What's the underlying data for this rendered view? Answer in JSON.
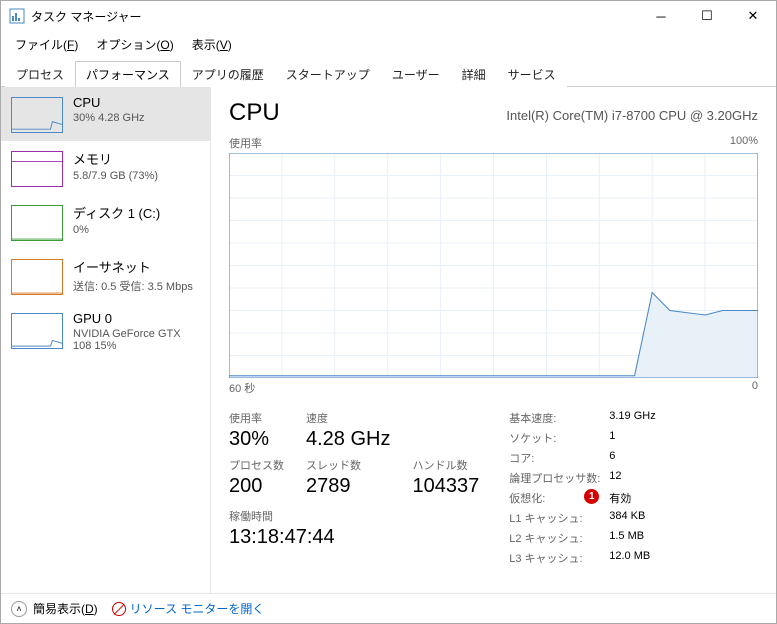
{
  "window": {
    "title": "タスク マネージャー"
  },
  "menu": {
    "file": "ファイル(F)",
    "options": "オプション(O)",
    "view": "表示(V)"
  },
  "tabs": [
    "プロセス",
    "パフォーマンス",
    "アプリの履歴",
    "スタートアップ",
    "ユーザー",
    "詳細",
    "サービス"
  ],
  "sidebar": [
    {
      "title": "CPU",
      "sub": "30% 4.28 GHz",
      "color": "#4a88c7"
    },
    {
      "title": "メモリ",
      "sub": "5.8/7.9 GB (73%)",
      "color": "#9b2fae"
    },
    {
      "title": "ディスク 1 (C:)",
      "sub": "0%",
      "color": "#3a9e3a"
    },
    {
      "title": "イーサネット",
      "sub": "送信: 0.5 受信: 3.5 Mbps",
      "color": "#d67a2a"
    },
    {
      "title": "GPU 0",
      "sub": "NVIDIA GeForce GTX 108 15%",
      "color": "#4a88c7"
    }
  ],
  "main": {
    "title": "CPU",
    "model": "Intel(R) Core(TM) i7-8700 CPU @ 3.20GHz",
    "chartTop": {
      "left": "使用率",
      "right": "100%"
    },
    "chartBottom": {
      "left": "60 秒",
      "right": "0"
    },
    "big": [
      {
        "lbl": "使用率",
        "val": "30%"
      },
      {
        "lbl": "速度",
        "val": "4.28 GHz"
      },
      {
        "lbl": "",
        "val": ""
      },
      {
        "lbl": "プロセス数",
        "val": "200"
      },
      {
        "lbl": "スレッド数",
        "val": "2789"
      },
      {
        "lbl": "ハンドル数",
        "val": "104337"
      }
    ],
    "uptime": {
      "lbl": "稼働時間",
      "val": "13:18:47:44"
    },
    "info": [
      {
        "k": "基本速度:",
        "v": "3.19 GHz"
      },
      {
        "k": "ソケット:",
        "v": "1"
      },
      {
        "k": "コア:",
        "v": "6"
      },
      {
        "k": "論理プロセッサ数:",
        "v": "12"
      },
      {
        "k": "仮想化:",
        "v": "有効",
        "badge": "1"
      },
      {
        "k": "L1 キャッシュ:",
        "v": "384 KB"
      },
      {
        "k": "L2 キャッシュ:",
        "v": "1.5 MB"
      },
      {
        "k": "L3 キャッシュ:",
        "v": "12.0 MB"
      }
    ]
  },
  "footer": {
    "fewer": "簡易表示(D)",
    "rmon": "リソース モニターを開く"
  },
  "chart_data": {
    "type": "line",
    "title": "使用率",
    "xlabel": "60 秒",
    "ylabel": "",
    "ylim": [
      0,
      100
    ],
    "x_seconds_ago": [
      60,
      58,
      56,
      54,
      52,
      50,
      48,
      46,
      44,
      42,
      40,
      38,
      36,
      34,
      32,
      30,
      28,
      26,
      24,
      22,
      20,
      18,
      16,
      14,
      12,
      10,
      8,
      6,
      4,
      2,
      0
    ],
    "values": [
      1,
      1,
      1,
      1,
      1,
      1,
      1,
      1,
      1,
      1,
      1,
      1,
      1,
      1,
      1,
      1,
      1,
      1,
      1,
      1,
      1,
      1,
      1,
      1,
      38,
      30,
      29,
      28,
      30,
      30,
      30
    ]
  }
}
